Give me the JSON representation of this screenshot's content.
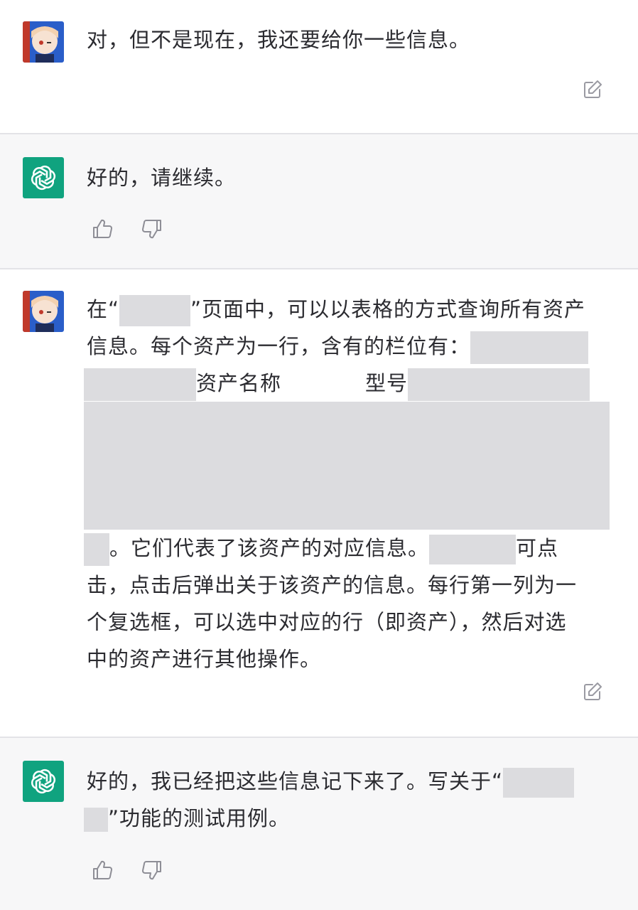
{
  "conversation": [
    {
      "role": "user",
      "text": "对，但不是现在，我还要给你一些信息。"
    },
    {
      "role": "assistant",
      "text": "好的，请继续。"
    },
    {
      "role": "user",
      "parts": {
        "p1": "在“",
        "p2": "”页面中，可以以表格的方式查询所有资产",
        "p3": "信息。每个资产为一行，含有的栏位有：",
        "p4": "资产名称",
        "p5": "型号",
        "p6": "。它们代表了该资产的对应信息。",
        "p7": "可点",
        "p8": "击，点击后弹出关于该资产的信息。每行第一列为一",
        "p9": "个复选框，可以选中对应的行（即资产），然后对选",
        "p10": "中的资产进行其他操作。"
      }
    },
    {
      "role": "assistant",
      "parts": {
        "p1": "好的，我已经把这些信息记下来了。写关于“",
        "p2": "”功能的测试用例。"
      }
    }
  ],
  "icons": {
    "edit": "edit-icon",
    "thumbs_up": "thumbs-up-icon",
    "thumbs_down": "thumbs-down-icon",
    "bot": "openai-logo-icon"
  },
  "colors": {
    "bot_avatar": "#10a37f",
    "assistant_bg": "#f7f7f8",
    "redaction": "#dcdcdf"
  }
}
